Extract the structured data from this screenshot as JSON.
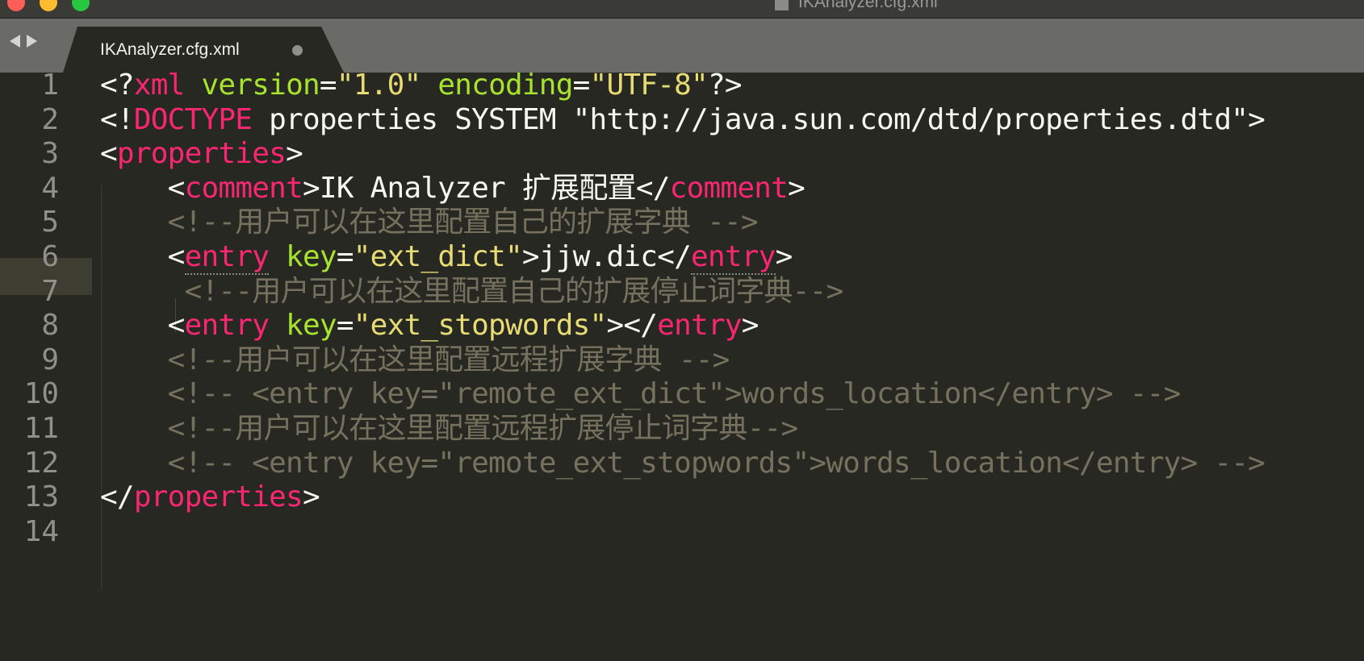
{
  "window": {
    "title": "IKAnalyzer.cfg.xml"
  },
  "tab": {
    "label": "IKAnalyzer.cfg.xml",
    "dirty": true
  },
  "colors": {
    "background": "#272822",
    "tag": "#f92672",
    "attribute": "#a6e22e",
    "string": "#e6db74",
    "text": "#f8f8f2",
    "comment": "#75715e",
    "line_number": "#90908a",
    "current_line_gutter": "#3e3d32"
  },
  "editor": {
    "current_line": 6,
    "lines": [
      {
        "n": "1",
        "indent": "",
        "tokens": [
          {
            "t": "<?",
            "k": "punct"
          },
          {
            "t": "xml",
            "k": "tag"
          },
          {
            "t": " ",
            "k": "txt"
          },
          {
            "t": "version",
            "k": "attr"
          },
          {
            "t": "=",
            "k": "punct"
          },
          {
            "t": "\"1.0\"",
            "k": "str"
          },
          {
            "t": " ",
            "k": "txt"
          },
          {
            "t": "encoding",
            "k": "attr"
          },
          {
            "t": "=",
            "k": "punct"
          },
          {
            "t": "\"UTF-8\"",
            "k": "str"
          },
          {
            "t": "?>",
            "k": "punct"
          }
        ]
      },
      {
        "n": "2",
        "indent": "",
        "tokens": [
          {
            "t": "<!",
            "k": "punct"
          },
          {
            "t": "DOCTYPE",
            "k": "tag"
          },
          {
            "t": " properties SYSTEM \"http://java.sun.com/dtd/properties.dtd\">",
            "k": "txt"
          }
        ]
      },
      {
        "n": "3",
        "indent": "",
        "tokens": [
          {
            "t": "<",
            "k": "punct"
          },
          {
            "t": "properties",
            "k": "tag"
          },
          {
            "t": ">",
            "k": "punct"
          }
        ]
      },
      {
        "n": "4",
        "indent": "    ",
        "tokens": [
          {
            "t": "<",
            "k": "punct"
          },
          {
            "t": "comment",
            "k": "tag"
          },
          {
            "t": ">",
            "k": "punct"
          },
          {
            "t": "IK Analyzer 扩展配置",
            "k": "txt"
          },
          {
            "t": "</",
            "k": "punct"
          },
          {
            "t": "comment",
            "k": "tag"
          },
          {
            "t": ">",
            "k": "punct"
          }
        ]
      },
      {
        "n": "5",
        "indent": "    ",
        "tokens": [
          {
            "t": "<!--用户可以在这里配置自己的扩展字典 -->",
            "k": "cmt"
          }
        ]
      },
      {
        "n": "6",
        "indent": "    ",
        "tokens": [
          {
            "t": "<",
            "k": "punct"
          },
          {
            "t": "entry",
            "k": "tag",
            "u": true
          },
          {
            "t": " ",
            "k": "txt"
          },
          {
            "t": "key",
            "k": "attr"
          },
          {
            "t": "=",
            "k": "punct"
          },
          {
            "t": "\"ext_dict\"",
            "k": "str"
          },
          {
            "t": ">",
            "k": "punct"
          },
          {
            "t": "jjw.dic",
            "k": "txt"
          },
          {
            "t": "</",
            "k": "punct"
          },
          {
            "t": "entry",
            "k": "tag",
            "u": true
          },
          {
            "t": ">",
            "k": "punct"
          }
        ]
      },
      {
        "n": "7",
        "indent": "     ",
        "tokens": [
          {
            "t": "<!--用户可以在这里配置自己的扩展停止词字典-->",
            "k": "cmt"
          }
        ]
      },
      {
        "n": "8",
        "indent": "    ",
        "tokens": [
          {
            "t": "<",
            "k": "punct"
          },
          {
            "t": "entry",
            "k": "tag"
          },
          {
            "t": " ",
            "k": "txt"
          },
          {
            "t": "key",
            "k": "attr"
          },
          {
            "t": "=",
            "k": "punct"
          },
          {
            "t": "\"ext_stopwords\"",
            "k": "str"
          },
          {
            "t": "></",
            "k": "punct"
          },
          {
            "t": "entry",
            "k": "tag"
          },
          {
            "t": ">",
            "k": "punct"
          }
        ]
      },
      {
        "n": "9",
        "indent": "    ",
        "tokens": [
          {
            "t": "<!--用户可以在这里配置远程扩展字典 -->",
            "k": "cmt"
          }
        ]
      },
      {
        "n": "10",
        "indent": "    ",
        "tokens": [
          {
            "t": "<!-- <entry key=\"remote_ext_dict\">words_location</entry> -->",
            "k": "cmt"
          }
        ]
      },
      {
        "n": "11",
        "indent": "    ",
        "tokens": [
          {
            "t": "<!--用户可以在这里配置远程扩展停止词字典-->",
            "k": "cmt"
          }
        ]
      },
      {
        "n": "12",
        "indent": "    ",
        "tokens": [
          {
            "t": "<!-- <entry key=\"remote_ext_stopwords\">words_location</entry> -->",
            "k": "cmt"
          }
        ]
      },
      {
        "n": "13",
        "indent": "",
        "tokens": [
          {
            "t": "</",
            "k": "punct"
          },
          {
            "t": "properties",
            "k": "tag"
          },
          {
            "t": ">",
            "k": "punct"
          }
        ]
      },
      {
        "n": "14",
        "indent": "",
        "tokens": []
      }
    ]
  }
}
